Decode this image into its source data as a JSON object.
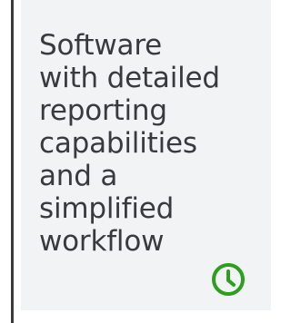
{
  "card": {
    "text": "Software\nwith detailed\nreporting\ncapabilities\nand a\nsimplified\nworkflow"
  },
  "icon": {
    "name": "clock-icon",
    "color": "#2ca01c"
  }
}
